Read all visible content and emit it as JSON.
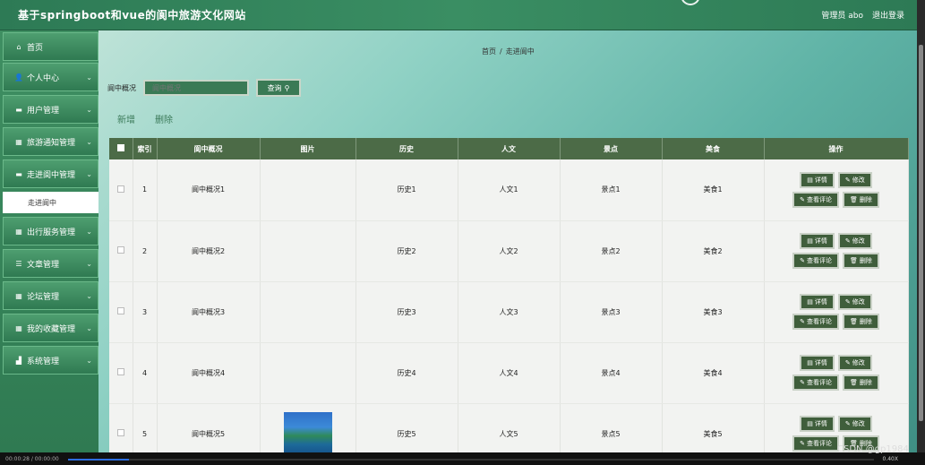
{
  "header": {
    "title": "基于springboot和vue的阆中旅游文化网站",
    "user": "管理员 abo",
    "logout": "退出登录"
  },
  "sidebar": {
    "items": [
      {
        "label": "首页",
        "icon": "home-icon",
        "glyph": "⌂",
        "expandable": false
      },
      {
        "label": "个人中心",
        "icon": "user-icon",
        "glyph": "👤",
        "expandable": true
      },
      {
        "label": "用户管理",
        "icon": "monitor-icon",
        "glyph": "▬",
        "expandable": true
      },
      {
        "label": "旅游通知管理",
        "icon": "grid-icon",
        "glyph": "▦",
        "expandable": true
      },
      {
        "label": "走进阆中管理",
        "icon": "monitor-icon",
        "glyph": "▬",
        "expandable": true
      },
      {
        "label": "出行服务管理",
        "icon": "grid-icon",
        "glyph": "▦",
        "expandable": true
      },
      {
        "label": "文章管理",
        "icon": "list-icon",
        "glyph": "☰",
        "expandable": true
      },
      {
        "label": "论坛管理",
        "icon": "grid-icon",
        "glyph": "▦",
        "expandable": true
      },
      {
        "label": "我的收藏管理",
        "icon": "grid-icon",
        "glyph": "▦",
        "expandable": true
      },
      {
        "label": "系统管理",
        "icon": "chart-icon",
        "glyph": "▟",
        "expandable": true
      }
    ],
    "active_sub": "走进阆中"
  },
  "breadcrumb": {
    "home": "首页",
    "sep": "/",
    "current": "走进阆中"
  },
  "search": {
    "label": "阆中概况",
    "placeholder": "阆中概况",
    "button": "查询"
  },
  "actions": {
    "add": "新增",
    "delete": "删除"
  },
  "table": {
    "headers": [
      "索引",
      "阆中概况",
      "图片",
      "历史",
      "人文",
      "景点",
      "美食",
      "操作"
    ],
    "rows": [
      {
        "index": "1",
        "overview": "阆中概况1",
        "history": "历史1",
        "culture": "人文1",
        "scenic": "景点1",
        "food": "美食1",
        "has_image": false
      },
      {
        "index": "2",
        "overview": "阆中概况2",
        "history": "历史2",
        "culture": "人文2",
        "scenic": "景点2",
        "food": "美食2",
        "has_image": false
      },
      {
        "index": "3",
        "overview": "阆中概况3",
        "history": "历史3",
        "culture": "人文3",
        "scenic": "景点3",
        "food": "美食3",
        "has_image": false
      },
      {
        "index": "4",
        "overview": "阆中概况4",
        "history": "历史4",
        "culture": "人文4",
        "scenic": "景点4",
        "food": "美食4",
        "has_image": false
      },
      {
        "index": "5",
        "overview": "阆中概况5",
        "history": "历史5",
        "culture": "人文5",
        "scenic": "景点5",
        "food": "美食5",
        "has_image": true
      }
    ],
    "row_buttons": {
      "detail": "详情",
      "edit": "修改",
      "comments": "查看评论",
      "remove": "删除"
    }
  },
  "player": {
    "time": "00:00:28 / 00:00:00",
    "zoom": "0.40X"
  },
  "watermark": "CSDN @gp1984"
}
